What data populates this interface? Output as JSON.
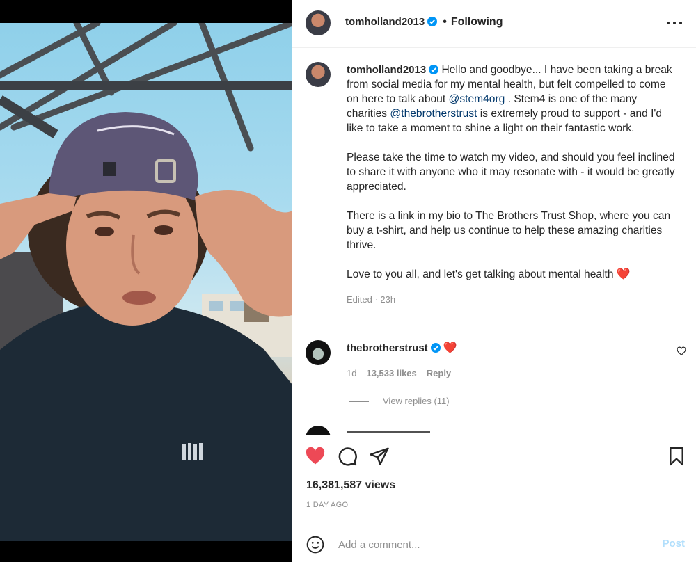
{
  "post": {
    "author": "tomholland2013",
    "follow_state": "Following",
    "separator": "•"
  },
  "caption": {
    "author": "tomholland2013",
    "p1_a": "Hello and goodbye... I have been taking a break from social media for my mental health, but felt compelled to come on here to talk about ",
    "p1_mention1": "@stem4org",
    "p1_b": " . Stem4 is one of the many charities ",
    "p1_mention2": "@thebrotherstrust",
    "p1_c": " is extremely proud to support - and I'd like to take a moment to shine a light on their fantastic work.",
    "p2": "Please take the time to watch my video, and should you feel inclined to share it with anyone who it may resonate with - it would be greatly appreciated.",
    "p3": "There is a link in my bio to The Brothers Trust Shop, where you can buy a t-shirt, and help us continue to help these amazing charities thrive.",
    "p4": "Love to you all, and let's get talking about mental health ",
    "p4_emoji": "❤️",
    "edited": "Edited · 23h"
  },
  "comment": {
    "author": "thebrotherstrust",
    "text": "❤️",
    "age": "1d",
    "likes": "13,533 likes",
    "reply": "Reply",
    "view_replies": "View replies (11)"
  },
  "actions": {
    "views": "16,381,587 views",
    "date": "1 DAY AGO",
    "liked": true
  },
  "add_comment": {
    "placeholder": "Add a comment...",
    "post_label": "Post"
  },
  "colors": {
    "accent": "#0095f6",
    "like": "#ed4956",
    "verified": "#0095f6",
    "mention": "#00376b"
  },
  "icons": [
    "verified-badge-icon",
    "more-options-icon",
    "heart-icon",
    "comment-icon",
    "share-icon",
    "bookmark-icon",
    "emoji-icon"
  ]
}
